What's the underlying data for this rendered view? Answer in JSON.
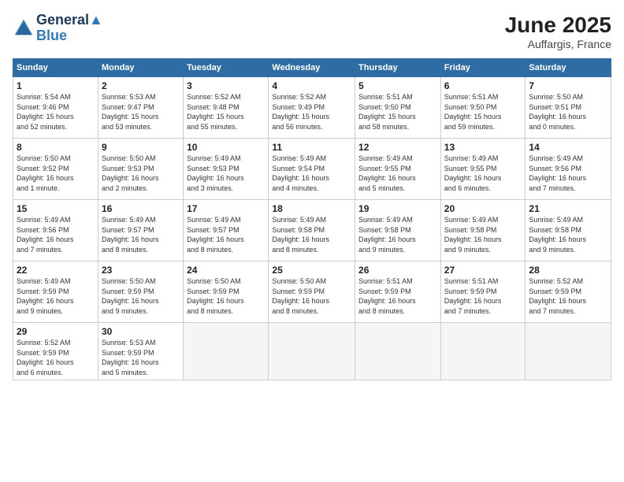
{
  "header": {
    "logo_line1": "General",
    "logo_line2": "Blue",
    "month_title": "June 2025",
    "location": "Auffargis, France"
  },
  "weekdays": [
    "Sunday",
    "Monday",
    "Tuesday",
    "Wednesday",
    "Thursday",
    "Friday",
    "Saturday"
  ],
  "weeks": [
    [
      {
        "day": "1",
        "info": "Sunrise: 5:54 AM\nSunset: 9:46 PM\nDaylight: 15 hours\nand 52 minutes."
      },
      {
        "day": "2",
        "info": "Sunrise: 5:53 AM\nSunset: 9:47 PM\nDaylight: 15 hours\nand 53 minutes."
      },
      {
        "day": "3",
        "info": "Sunrise: 5:52 AM\nSunset: 9:48 PM\nDaylight: 15 hours\nand 55 minutes."
      },
      {
        "day": "4",
        "info": "Sunrise: 5:52 AM\nSunset: 9:49 PM\nDaylight: 15 hours\nand 56 minutes."
      },
      {
        "day": "5",
        "info": "Sunrise: 5:51 AM\nSunset: 9:50 PM\nDaylight: 15 hours\nand 58 minutes."
      },
      {
        "day": "6",
        "info": "Sunrise: 5:51 AM\nSunset: 9:50 PM\nDaylight: 15 hours\nand 59 minutes."
      },
      {
        "day": "7",
        "info": "Sunrise: 5:50 AM\nSunset: 9:51 PM\nDaylight: 16 hours\nand 0 minutes."
      }
    ],
    [
      {
        "day": "8",
        "info": "Sunrise: 5:50 AM\nSunset: 9:52 PM\nDaylight: 16 hours\nand 1 minute."
      },
      {
        "day": "9",
        "info": "Sunrise: 5:50 AM\nSunset: 9:53 PM\nDaylight: 16 hours\nand 2 minutes."
      },
      {
        "day": "10",
        "info": "Sunrise: 5:49 AM\nSunset: 9:53 PM\nDaylight: 16 hours\nand 3 minutes."
      },
      {
        "day": "11",
        "info": "Sunrise: 5:49 AM\nSunset: 9:54 PM\nDaylight: 16 hours\nand 4 minutes."
      },
      {
        "day": "12",
        "info": "Sunrise: 5:49 AM\nSunset: 9:55 PM\nDaylight: 16 hours\nand 5 minutes."
      },
      {
        "day": "13",
        "info": "Sunrise: 5:49 AM\nSunset: 9:55 PM\nDaylight: 16 hours\nand 6 minutes."
      },
      {
        "day": "14",
        "info": "Sunrise: 5:49 AM\nSunset: 9:56 PM\nDaylight: 16 hours\nand 7 minutes."
      }
    ],
    [
      {
        "day": "15",
        "info": "Sunrise: 5:49 AM\nSunset: 9:56 PM\nDaylight: 16 hours\nand 7 minutes."
      },
      {
        "day": "16",
        "info": "Sunrise: 5:49 AM\nSunset: 9:57 PM\nDaylight: 16 hours\nand 8 minutes."
      },
      {
        "day": "17",
        "info": "Sunrise: 5:49 AM\nSunset: 9:57 PM\nDaylight: 16 hours\nand 8 minutes."
      },
      {
        "day": "18",
        "info": "Sunrise: 5:49 AM\nSunset: 9:58 PM\nDaylight: 16 hours\nand 8 minutes."
      },
      {
        "day": "19",
        "info": "Sunrise: 5:49 AM\nSunset: 9:58 PM\nDaylight: 16 hours\nand 9 minutes."
      },
      {
        "day": "20",
        "info": "Sunrise: 5:49 AM\nSunset: 9:58 PM\nDaylight: 16 hours\nand 9 minutes."
      },
      {
        "day": "21",
        "info": "Sunrise: 5:49 AM\nSunset: 9:58 PM\nDaylight: 16 hours\nand 9 minutes."
      }
    ],
    [
      {
        "day": "22",
        "info": "Sunrise: 5:49 AM\nSunset: 9:59 PM\nDaylight: 16 hours\nand 9 minutes."
      },
      {
        "day": "23",
        "info": "Sunrise: 5:50 AM\nSunset: 9:59 PM\nDaylight: 16 hours\nand 9 minutes."
      },
      {
        "day": "24",
        "info": "Sunrise: 5:50 AM\nSunset: 9:59 PM\nDaylight: 16 hours\nand 8 minutes."
      },
      {
        "day": "25",
        "info": "Sunrise: 5:50 AM\nSunset: 9:59 PM\nDaylight: 16 hours\nand 8 minutes."
      },
      {
        "day": "26",
        "info": "Sunrise: 5:51 AM\nSunset: 9:59 PM\nDaylight: 16 hours\nand 8 minutes."
      },
      {
        "day": "27",
        "info": "Sunrise: 5:51 AM\nSunset: 9:59 PM\nDaylight: 16 hours\nand 7 minutes."
      },
      {
        "day": "28",
        "info": "Sunrise: 5:52 AM\nSunset: 9:59 PM\nDaylight: 16 hours\nand 7 minutes."
      }
    ],
    [
      {
        "day": "29",
        "info": "Sunrise: 5:52 AM\nSunset: 9:59 PM\nDaylight: 16 hours\nand 6 minutes."
      },
      {
        "day": "30",
        "info": "Sunrise: 5:53 AM\nSunset: 9:59 PM\nDaylight: 16 hours\nand 5 minutes."
      },
      {
        "day": "",
        "info": ""
      },
      {
        "day": "",
        "info": ""
      },
      {
        "day": "",
        "info": ""
      },
      {
        "day": "",
        "info": ""
      },
      {
        "day": "",
        "info": ""
      }
    ]
  ]
}
